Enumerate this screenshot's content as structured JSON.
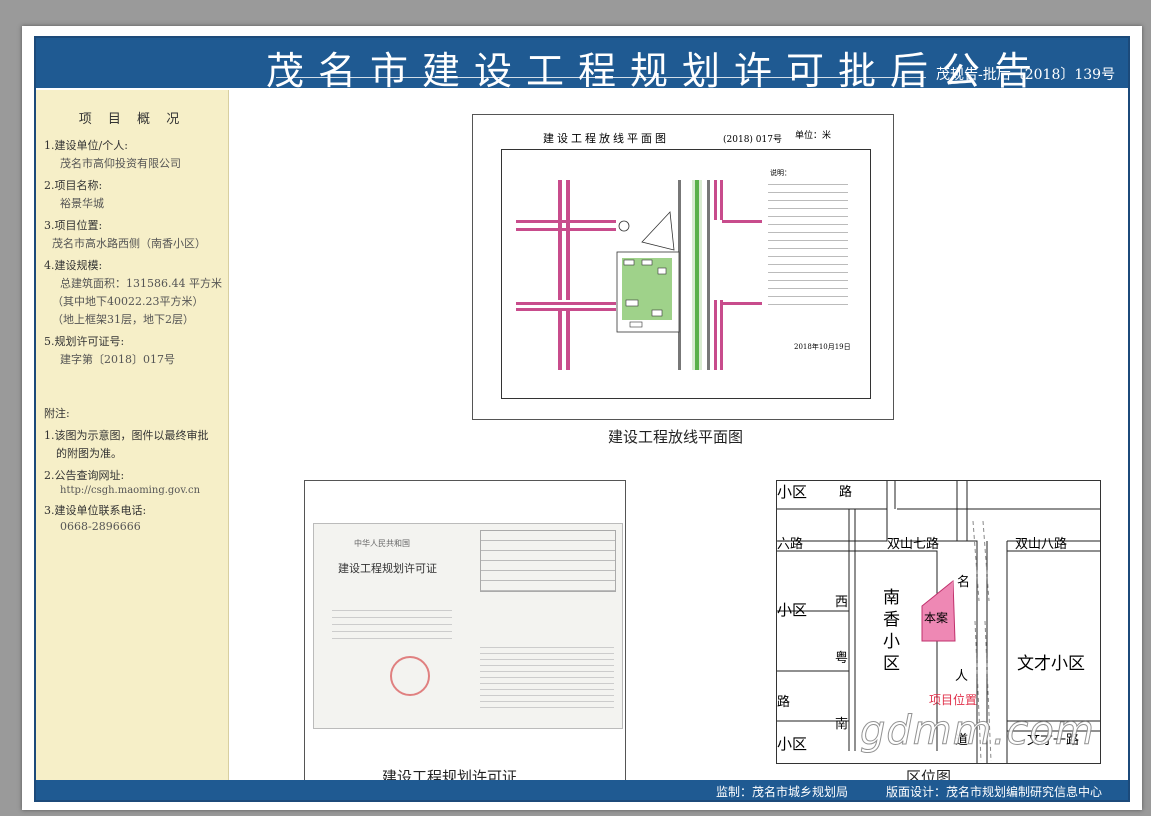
{
  "header": {
    "title": "茂名市建设工程规划许可批后公告",
    "doc_number": "茂规告-批后〔2018〕139号"
  },
  "sidebar": {
    "section_title": "项 目 概 况",
    "items": [
      {
        "label": "1.建设单位/个人:",
        "values": [
          "茂名市高仰投资有限公司"
        ]
      },
      {
        "label": "2.项目名称:",
        "values": [
          "裕景华城"
        ]
      },
      {
        "label": "3.项目位置:",
        "values": [
          "茂名市高水路西侧（南香小区）"
        ]
      },
      {
        "label": "4.建设规模:",
        "values": [
          "总建筑面积：131586.44 平方米",
          "（其中地下40022.23平方米）",
          "（地上框架31层，地下2层）"
        ]
      },
      {
        "label": "5.规划许可证号:",
        "values": [
          "建字第〔2018〕017号"
        ]
      }
    ],
    "notes_title": "附注:",
    "notes": [
      {
        "label": "1.该图为示意图，图件以最终审批",
        "values": [
          "的附图为准。"
        ]
      },
      {
        "label": "2.公告查询网址:",
        "values": [
          "http://csgh.maoming.gov.cn"
        ]
      },
      {
        "label": "3.建设单位联系电话:",
        "values": [
          "0668-2896666"
        ]
      }
    ]
  },
  "plan": {
    "title": "建设工程放线平面图",
    "number": "(2018) 017号",
    "unit": "单位：米",
    "date": "2018年10月19日",
    "caption": "建设工程放线平面图",
    "notes_head": "说明："
  },
  "permit": {
    "caption": "建设工程规划许可证",
    "doc_header": "中华人民共和国",
    "doc_title": "建设工程规划许可证"
  },
  "location": {
    "caption": "区位图",
    "labels": {
      "xiaoqu1": "小区",
      "shuangshan_rd": "双山七路",
      "shuangshan8": "双山八路",
      "liulu": "六路",
      "nanxiang": "南香小区",
      "benan": "本案",
      "wencai": "文才小区",
      "wencai_rd": "文才一路",
      "project_loc": "项目位置",
      "lu": "路",
      "xi": "西",
      "yue": "粤",
      "nan": "南",
      "ming": "名",
      "ren": "人",
      "dao": "道",
      "xiaoqu2": "小区",
      "xiaoqu3": "小区",
      "lu2": "路"
    }
  },
  "footer": {
    "supervisor": "监制：茂名市城乡规划局",
    "design": "版面设计：茂名市规划编制研究信息中心"
  },
  "watermark": "gdmm.com"
}
